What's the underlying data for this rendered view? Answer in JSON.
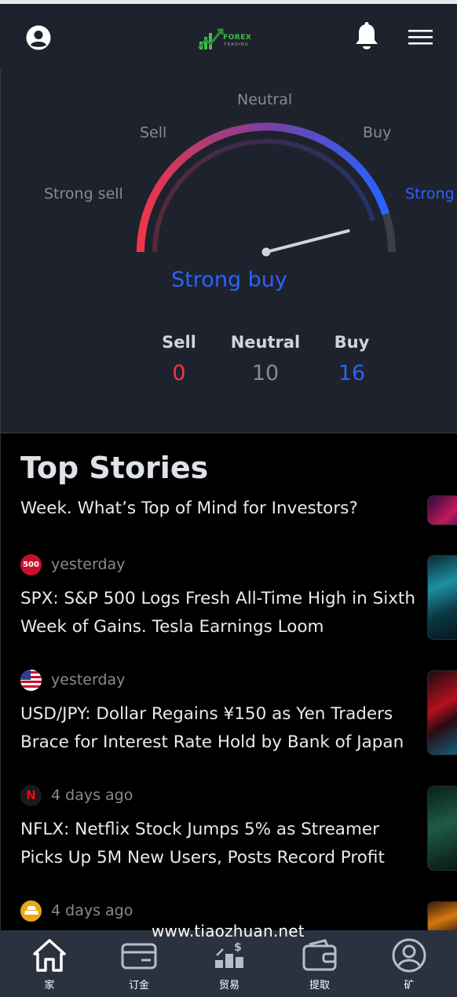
{
  "header": {
    "logo_line1": "FOREX",
    "logo_line2": "TRADING"
  },
  "gauge": {
    "labels": {
      "strong_sell": "Strong sell",
      "sell": "Sell",
      "neutral": "Neutral",
      "buy": "Buy",
      "strong_buy": "Strong"
    },
    "result": "Strong buy",
    "needle_position_fraction": 0.92,
    "counts": [
      {
        "label": "Sell",
        "value": "0",
        "color": "#f23645"
      },
      {
        "label": "Neutral",
        "value": "10",
        "color": "#868a93"
      },
      {
        "label": "Buy",
        "value": "16",
        "color": "#2962ff"
      }
    ],
    "colors": {
      "sell": "#f23645",
      "neutral": "#7b3fa0",
      "buy": "#2962ff"
    }
  },
  "stories": {
    "title": "Top Stories",
    "items": [
      {
        "time": "",
        "headline": "Week. What’s Top of Mind for Investors?",
        "source_icon": "partial"
      },
      {
        "time": "yesterday",
        "headline": "SPX: S&P 500 Logs Fresh All-Time High in Sixth Week of Gains. Tesla Earnings Loom",
        "source_icon": "sp500-icon",
        "source_text": "500"
      },
      {
        "time": "yesterday",
        "headline": "USD/JPY: Dollar Regains ¥150 as Yen Traders Brace for Interest Rate Hold by Bank of Japan",
        "source_icon": "us-flag-icon"
      },
      {
        "time": "4 days ago",
        "headline": "NFLX: Netflix Stock Jumps 5% as Streamer Picks Up 5M New Users, Posts Record Profit",
        "source_icon": "netflix-icon",
        "source_text": "N"
      },
      {
        "time": "4 days ago",
        "headline": "",
        "source_icon": "gold-icon"
      }
    ]
  },
  "watermark": "www.tiaozhuan.net",
  "nav": {
    "items": [
      {
        "label": "家",
        "icon": "home-icon"
      },
      {
        "label": "订金",
        "icon": "card-icon"
      },
      {
        "label": "贸易",
        "icon": "trade-icon"
      },
      {
        "label": "提取",
        "icon": "wallet-icon"
      },
      {
        "label": "矿",
        "icon": "user-icon"
      }
    ]
  }
}
